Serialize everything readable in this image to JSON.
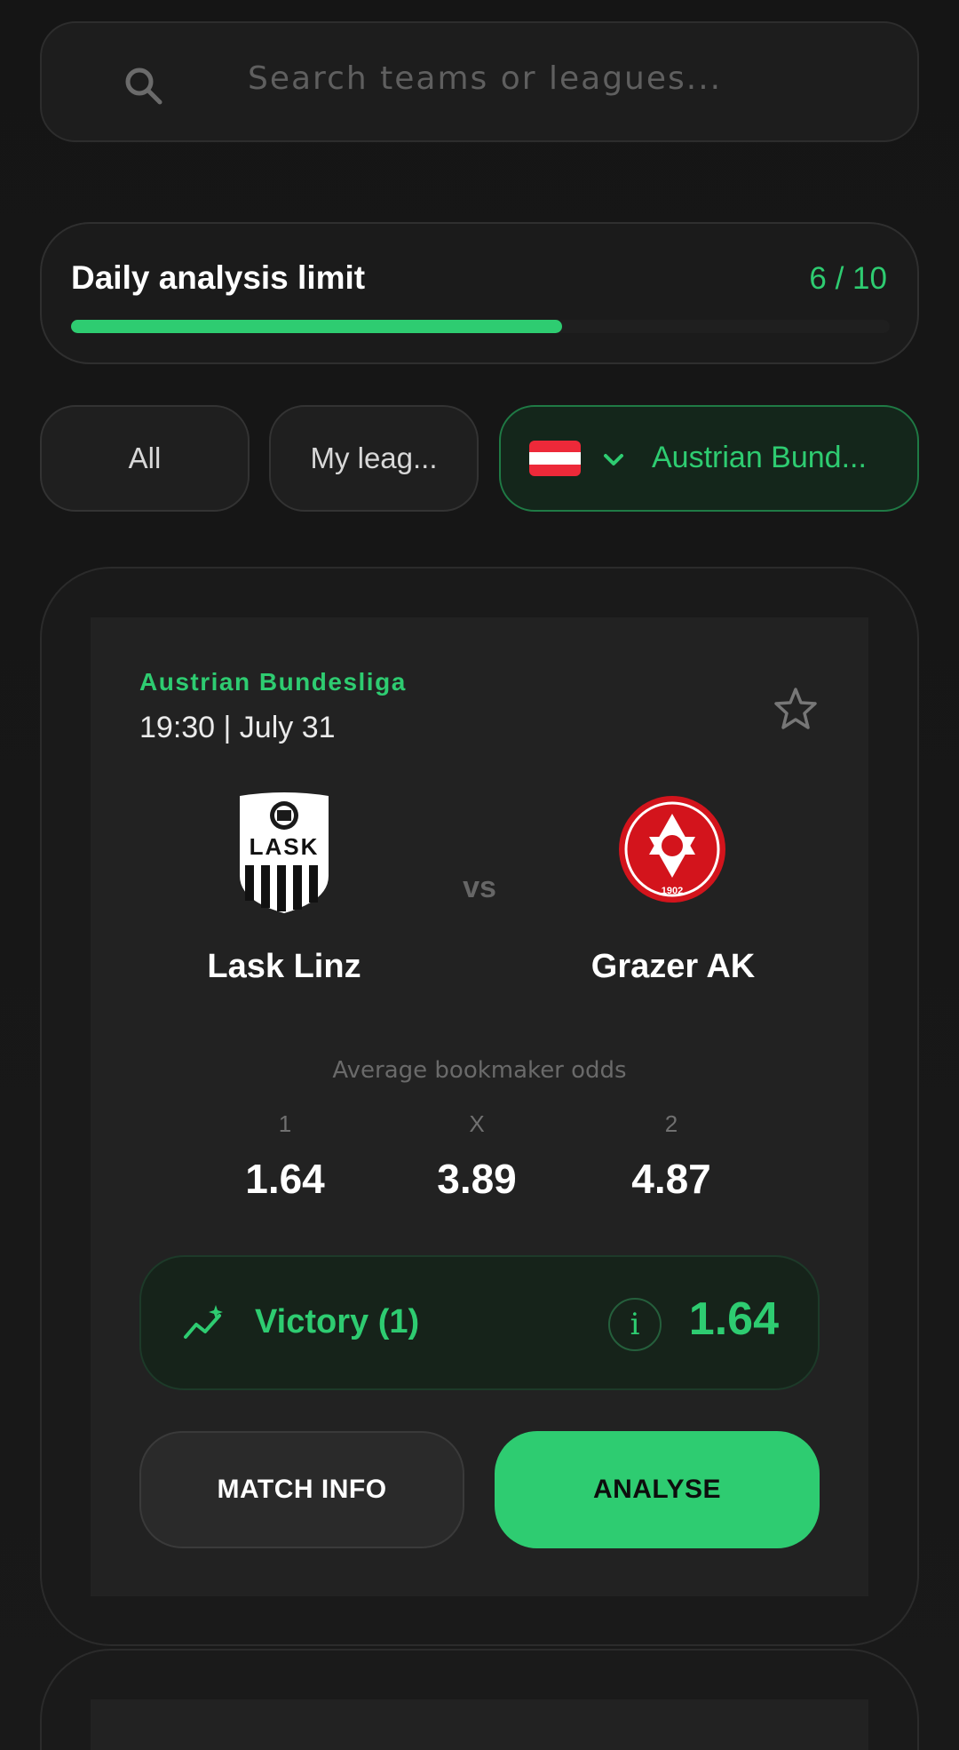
{
  "search": {
    "placeholder": "Search teams or leagues..."
  },
  "limit": {
    "title": "Daily analysis limit",
    "count": "6 / 10",
    "progress": 0.6
  },
  "filters": {
    "all": "All",
    "my_leagues": "My leag...",
    "selected_league": "Austrian Bund...",
    "flag_colors": [
      "#ed2939",
      "#ffffff",
      "#ed2939"
    ]
  },
  "match": {
    "league": "Austrian Bundesliga",
    "time": "19:30 | July 31",
    "home_team": "Lask Linz",
    "away_team": "Grazer AK",
    "vs": "vs",
    "home_crest_text": "LASK",
    "away_crest_year": "1902",
    "odds": {
      "title": "Average bookmaker odds",
      "labels": [
        "1",
        "X",
        "2"
      ],
      "values": [
        "1.64",
        "3.89",
        "4.87"
      ]
    },
    "prediction": {
      "label": "Victory (1)",
      "info": "i",
      "value": "1.64"
    },
    "buttons": {
      "match_info": "MATCH INFO",
      "analyse": "ANALYSE"
    }
  },
  "colors": {
    "accent": "#2ecc71",
    "background": "#161616",
    "card": "#222222"
  }
}
